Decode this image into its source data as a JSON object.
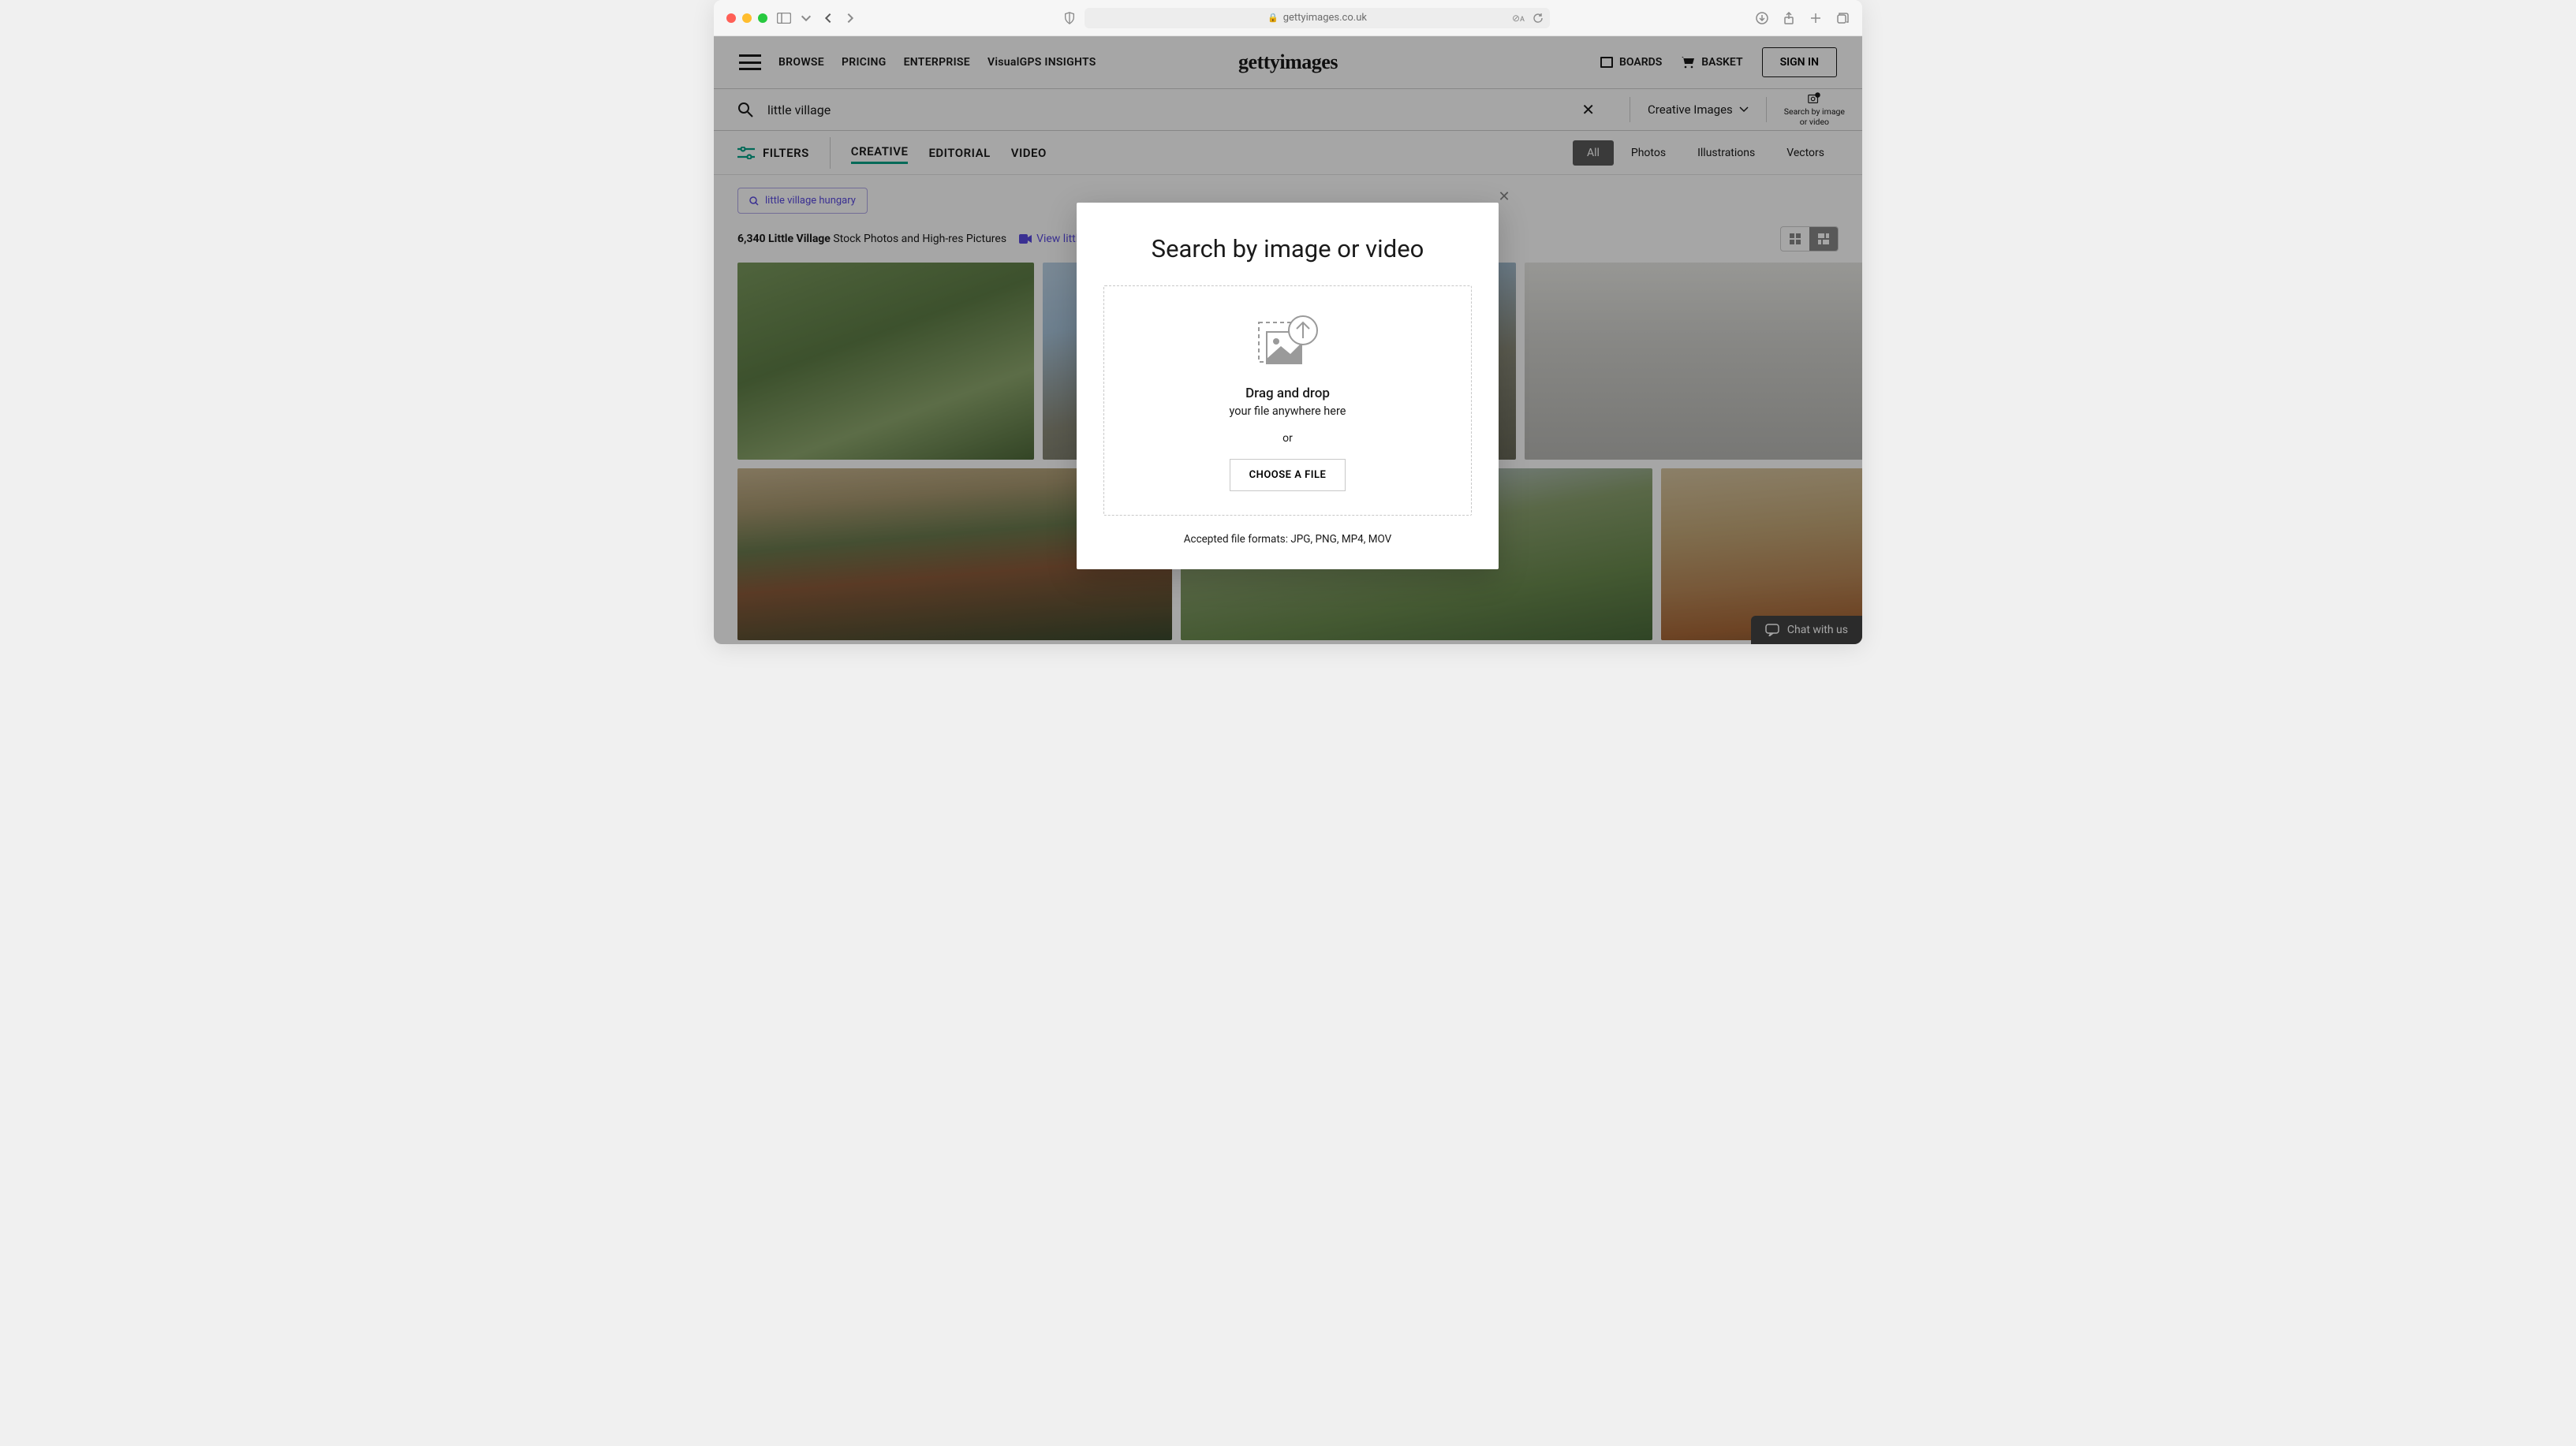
{
  "browser": {
    "url_display": "gettyimages.co.uk"
  },
  "nav": {
    "browse": "BROWSE",
    "pricing": "PRICING",
    "enterprise": "ENTERPRISE",
    "visualgps": "VisualGPS INSIGHTS",
    "logo": "gettyimages",
    "boards": "BOARDS",
    "basket": "BASKET",
    "signin": "SIGN IN"
  },
  "search": {
    "query": "little village",
    "dropdown": "Creative Images",
    "sbi_line1": "Search by image",
    "sbi_line2": "or video"
  },
  "filters": {
    "label": "FILTERS",
    "tabs": {
      "creative": "CREATIVE",
      "editorial": "EDITORIAL",
      "video": "VIDEO"
    },
    "pills": {
      "all": "All",
      "photos": "Photos",
      "illustrations": "Illustrations",
      "vectors": "Vectors"
    }
  },
  "chip": {
    "label": "little village hungary"
  },
  "results": {
    "count": "6,340 Little Village",
    "suffix": " Stock Photos and High-res Pictures",
    "videos_link": "View little villa"
  },
  "modal": {
    "title": "Search by image or video",
    "drag": "Drag and drop",
    "drag_sub": "your file anywhere here",
    "or": "or",
    "choose": "CHOOSE A FILE",
    "formats": "Accepted file formats: JPG, PNG, MP4, MOV"
  },
  "chat": {
    "label": "Chat with us"
  }
}
